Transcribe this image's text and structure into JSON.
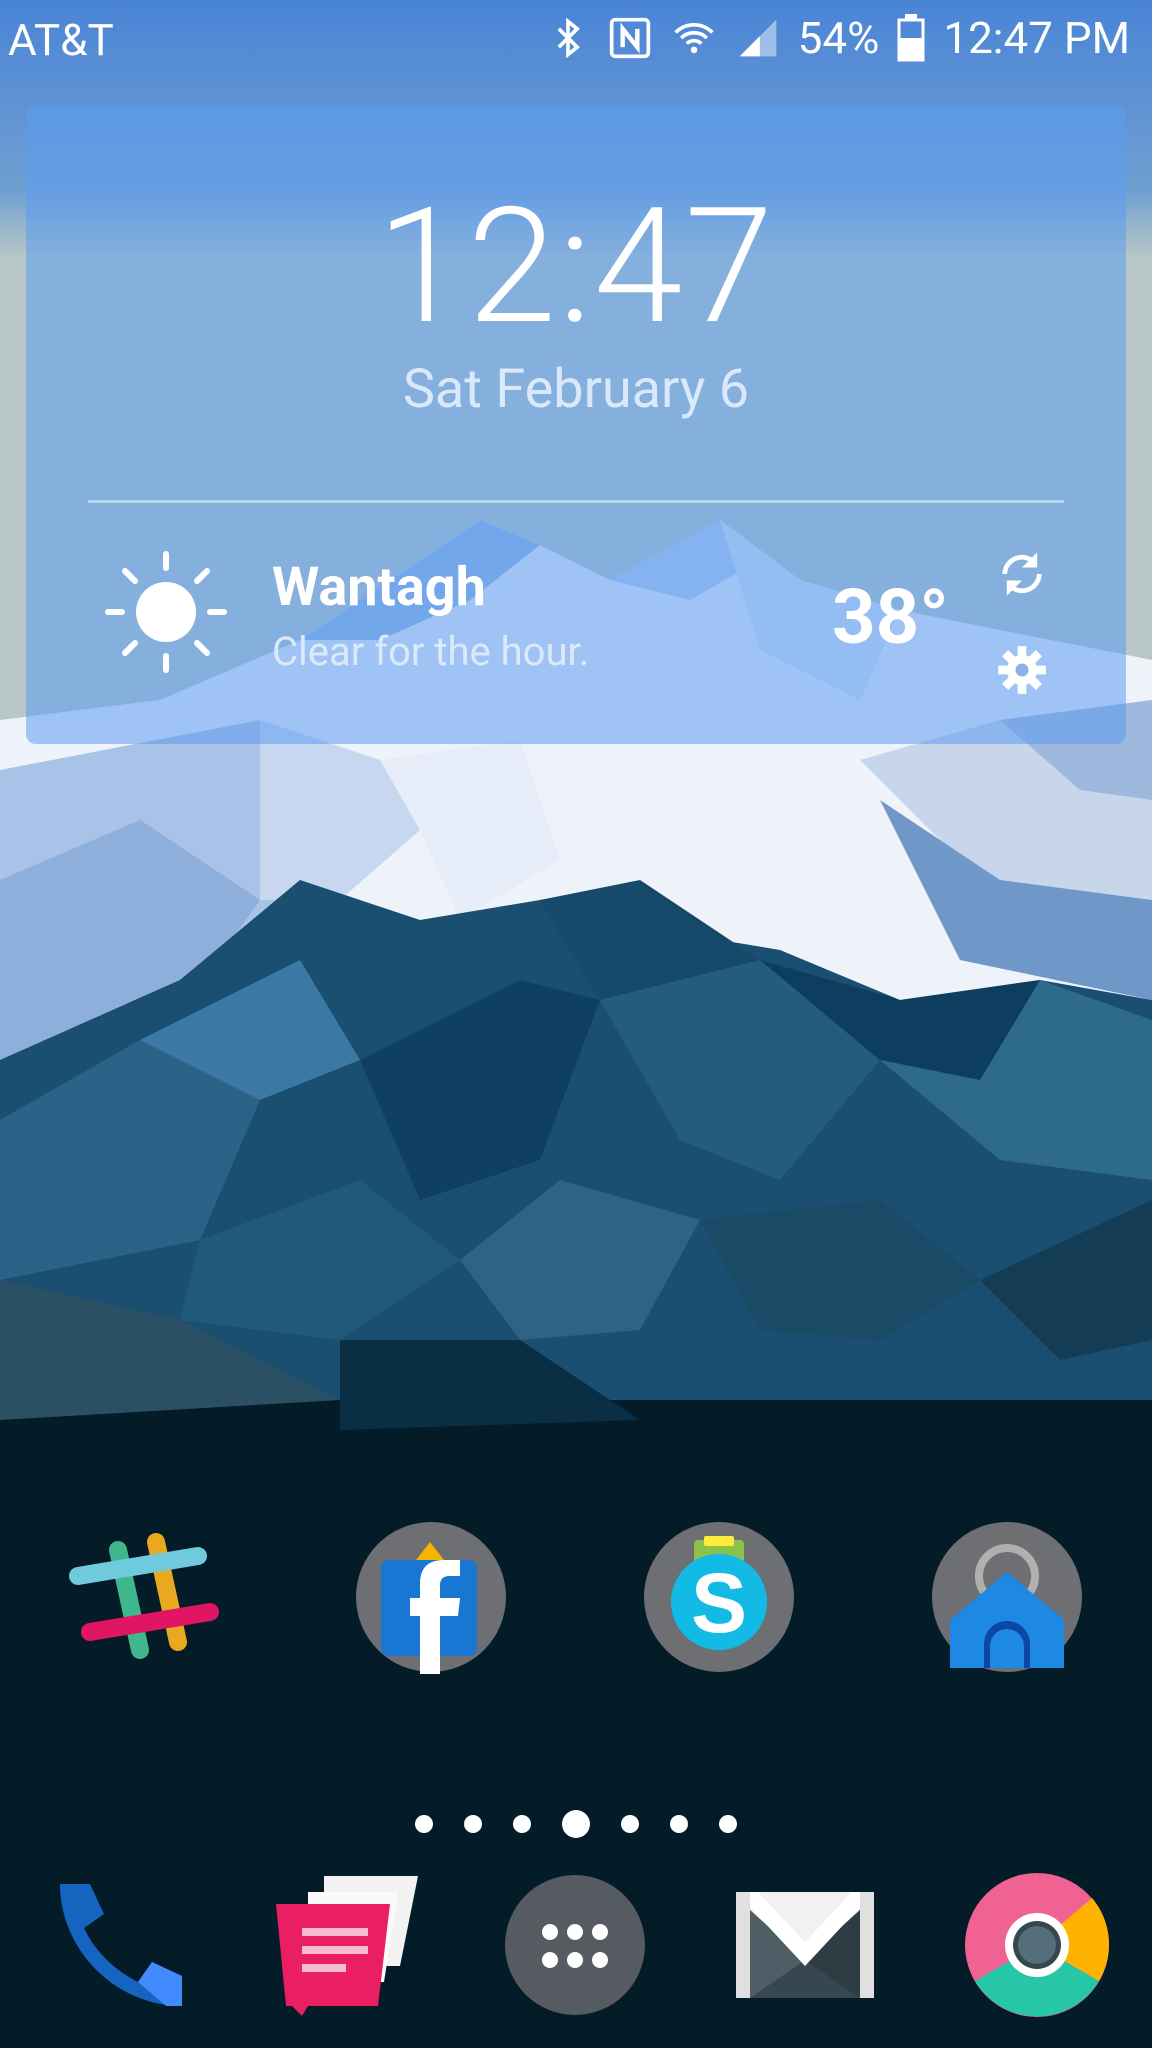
{
  "status_bar": {
    "carrier": "AT&T",
    "battery": "54%",
    "time": "12:47 PM",
    "icons": [
      "bluetooth-icon",
      "nfc-icon",
      "wifi-icon",
      "cell-signal-icon",
      "battery-icon"
    ]
  },
  "clock_widget": {
    "time": "12:47",
    "date": "Sat February 6"
  },
  "weather": {
    "location": "Wantagh",
    "summary": "Clear for the hour.",
    "temperature": "38°",
    "icon": "sun-icon"
  },
  "home_apps": [
    {
      "name": "Slack",
      "icon": "slack-icon"
    },
    {
      "name": "Facebook",
      "icon": "facebook-icon"
    },
    {
      "name": "Skype",
      "icon": "skype-icon"
    },
    {
      "name": "Home",
      "icon": "home-icon"
    }
  ],
  "page_indicator": {
    "pages": 7,
    "current": 4
  },
  "dock": [
    {
      "name": "Phone",
      "icon": "phone-icon"
    },
    {
      "name": "Messages",
      "icon": "messages-icon"
    },
    {
      "name": "All apps",
      "icon": "app-drawer-icon"
    },
    {
      "name": "Gmail",
      "icon": "gmail-icon"
    },
    {
      "name": "Chrome",
      "icon": "chrome-icon"
    }
  ],
  "colors": {
    "sky_top": "#4f8fe6",
    "snow": "#f4f6fb",
    "mountain_dark": "#0b3a5a",
    "ground": "#031c28",
    "widget_tint": "#5c9cf0"
  }
}
